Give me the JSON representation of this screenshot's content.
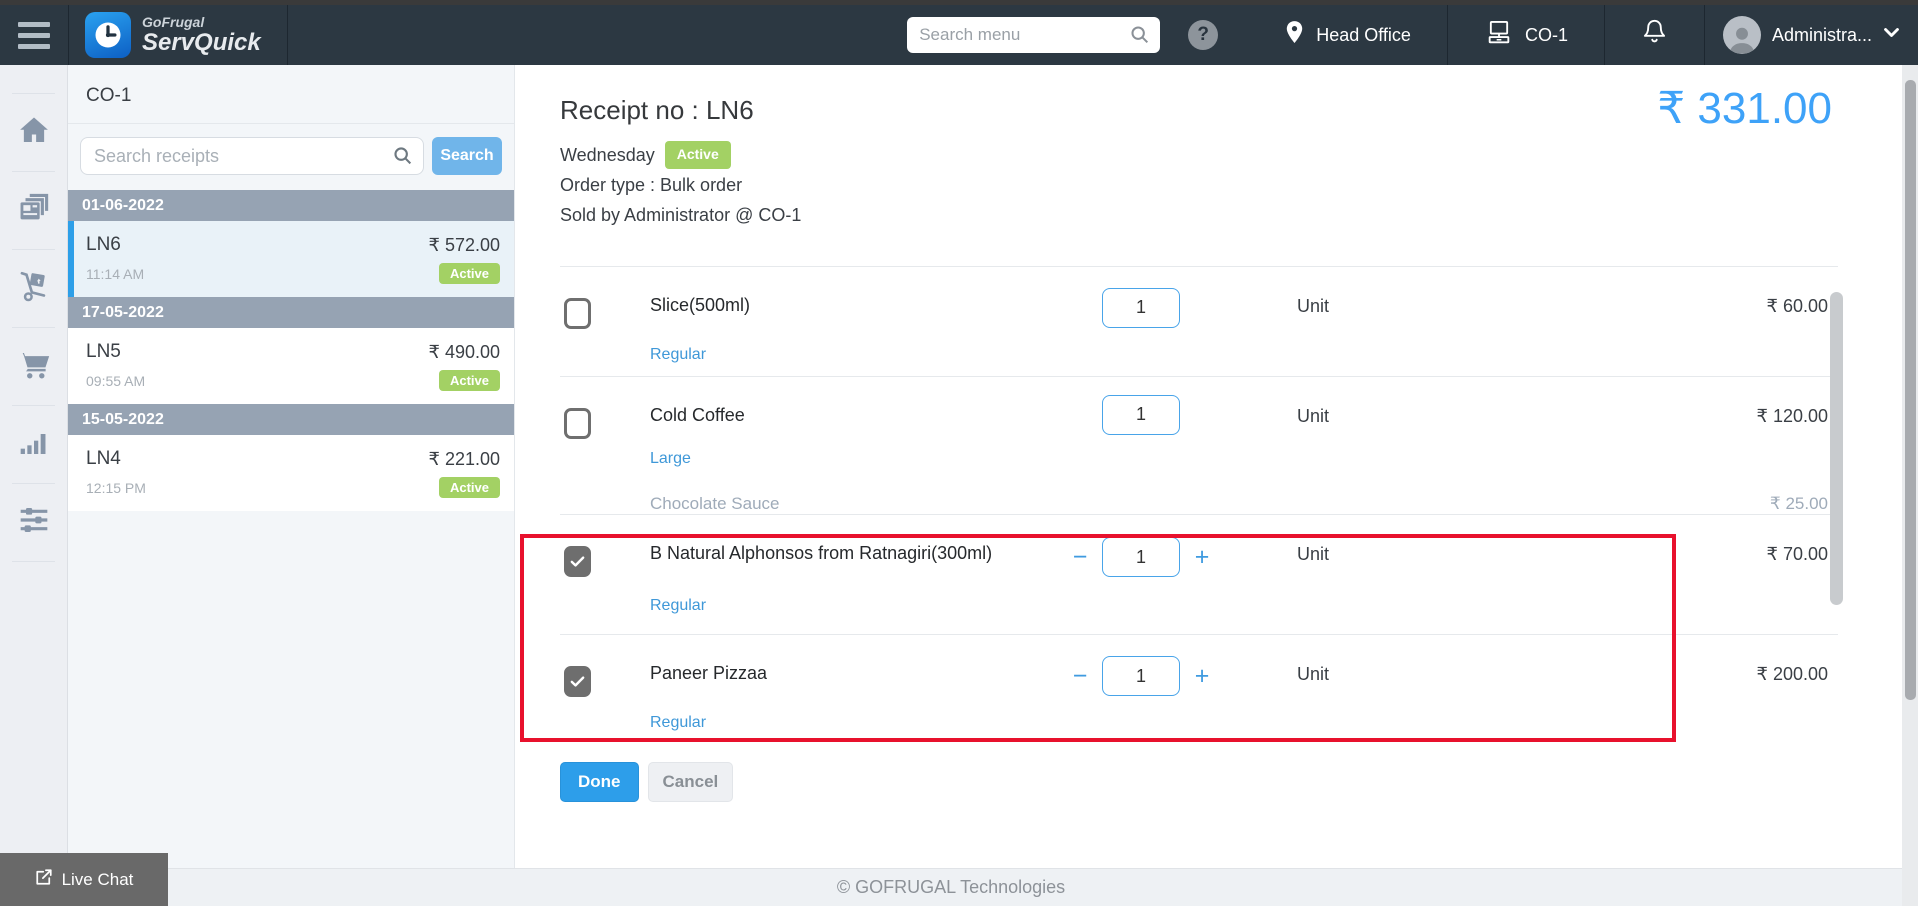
{
  "navbar": {
    "brand_top": "GoFrugal",
    "brand_bottom": "ServQuick",
    "search_placeholder": "Search menu",
    "help_label": "?",
    "location_label": "Head Office",
    "terminal_label": "CO-1",
    "user_label": "Administra..."
  },
  "sidebar": {
    "icons": [
      "home",
      "receipts",
      "delivery",
      "cart",
      "reports",
      "settings"
    ]
  },
  "receipts_panel": {
    "store_label": "CO-1",
    "search_placeholder": "Search receipts",
    "search_button_label": "Search",
    "groups": [
      {
        "date": "01-06-2022",
        "receipts": [
          {
            "id": "LN6",
            "time": "11:14 AM",
            "amount": "₹ 572.00",
            "status": "Active",
            "selected": true
          }
        ]
      },
      {
        "date": "17-05-2022",
        "receipts": [
          {
            "id": "LN5",
            "time": "09:55 AM",
            "amount": "₹ 490.00",
            "status": "Active",
            "selected": false
          }
        ]
      },
      {
        "date": "15-05-2022",
        "receipts": [
          {
            "id": "LN4",
            "time": "12:15 PM",
            "amount": "₹ 221.00",
            "status": "Active",
            "selected": false
          }
        ]
      }
    ]
  },
  "main": {
    "receipt_title": "Receipt no : LN6",
    "day_label": "Wednesday",
    "status_badge": "Active",
    "order_type_line": "Order type : Bulk order",
    "sold_by_line": "Sold by Administrator @ CO-1",
    "total_amount": "₹ 331.00",
    "stepper": {
      "minus": "−",
      "plus": "+"
    },
    "items": [
      {
        "name": "Slice(500ml)",
        "variant": "Regular",
        "qty": "1",
        "unit": "Unit",
        "price": "₹ 60.00",
        "checked": false
      },
      {
        "name": "Cold Coffee",
        "variant": "Large",
        "qty": "1",
        "unit": "Unit",
        "price": "₹ 120.00",
        "checked": false,
        "addon_name": "Chocolate Sauce",
        "addon_price": "₹ 25.00"
      },
      {
        "name": "B Natural Alphonsos from Ratnagiri(300ml)",
        "variant": "Regular",
        "qty": "1",
        "unit": "Unit",
        "price": "₹ 70.00",
        "checked": true
      },
      {
        "name": "Paneer Pizzaa",
        "variant": "Regular",
        "qty": "1",
        "unit": "Unit",
        "price": "₹ 200.00",
        "checked": true
      }
    ],
    "done_button_label": "Done",
    "cancel_button_label": "Cancel"
  },
  "footer": {
    "copyright": "© GOFRUGAL Technologies",
    "live_chat_label": "Live Chat"
  },
  "colors": {
    "navbar_bg": "#2C3842",
    "accent_blue": "#2D9FE8",
    "active_green": "#A3D164",
    "total_blue": "#3EA2F8",
    "highlight_red": "#E8112D"
  }
}
